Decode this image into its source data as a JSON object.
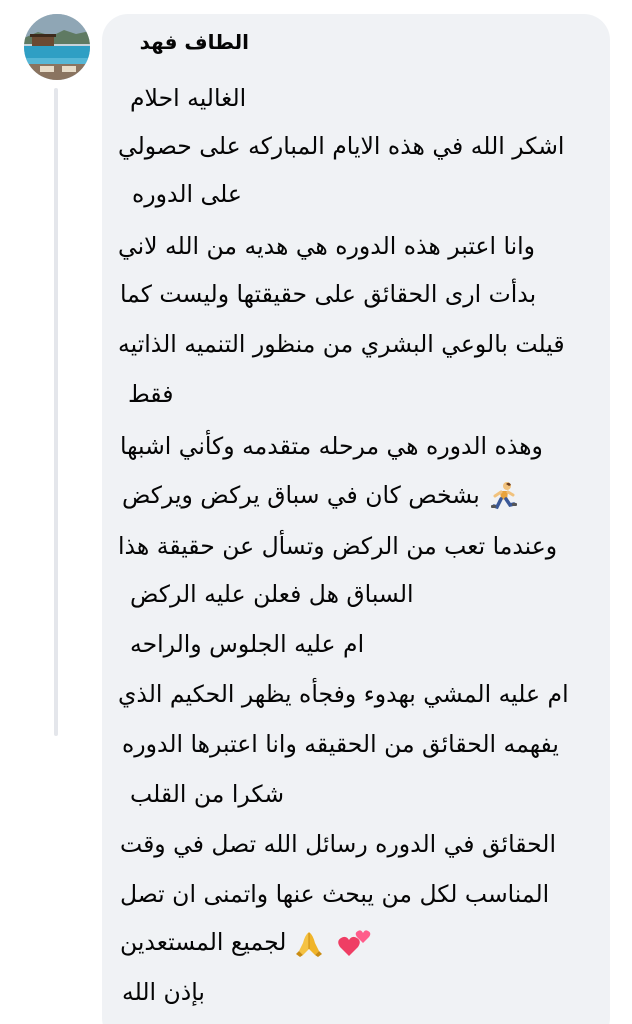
{
  "comment": {
    "author": "الطاف فهد",
    "lines": [
      "الغاليه احلام",
      "اشكر الله في هذه الايام المباركه على حصولي",
      "على الدوره",
      "وانا اعتبر هذه الدوره هي هديه من الله لاني",
      "بدأت ارى الحقائق على حقيقتها وليست كما",
      "قيلت بالوعي البشري من منظور التنميه الذاتيه",
      "فقط",
      "وهذه الدوره هي مرحله متقدمه وكأني اشبها",
      "بشخص كان في سباق يركض ويركض",
      "وعندما تعب من الركض وتسأل عن حقيقة هذا",
      "السباق هل فعلن عليه الركض",
      "ام عليه الجلوس والراحه",
      "ام عليه المشي بهدوء وفجأه يظهر الحكيم الذي",
      "يفهمه الحقائق من الحقيقه وانا اعتبرها الدوره",
      "شكرا من القلب",
      "الحقائق في الدوره رسائل الله تصل في وقت",
      "المناسب لكل من يبحث عنها واتمنى ان تصل",
      "لجميع المستعدين",
      "بإذن الله"
    ],
    "emojis": {
      "runner": "running-person-icon",
      "pray": "folded-hands-icon",
      "hearts": "two-hearts-icon"
    }
  },
  "colors": {
    "bubble": "#f0f2f5",
    "text": "#050505",
    "thread": "#e4e6eb"
  }
}
